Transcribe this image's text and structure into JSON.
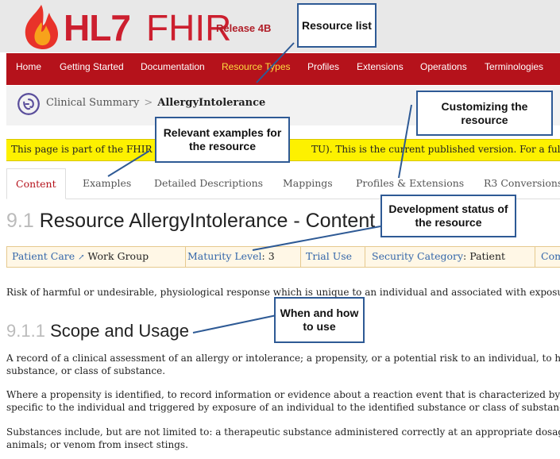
{
  "header": {
    "brand_hl7": "HL7",
    "brand_fhir": "FHIR",
    "release": "Release 4B"
  },
  "nav": [
    "Home",
    "Getting Started",
    "Documentation",
    "Resource Types",
    "Profiles",
    "Extensions",
    "Operations",
    "Terminologies"
  ],
  "breadcrumb": {
    "parent": "Clinical Summary",
    "sep": ">",
    "current": "AllergyIntolerance"
  },
  "notice": {
    "start": "This page is part of the FHIR S",
    "end": "TU). This is the current published version. For a full list o"
  },
  "tabs": [
    "Content",
    "Examples",
    "Detailed Descriptions",
    "Mappings",
    "Profiles & Extensions",
    "R3 Conversions"
  ],
  "title": {
    "num": "9.1",
    "text": "Resource AllergyIntolerance - Content"
  },
  "workgroup": {
    "patient_care": "Patient Care",
    "work_group": "Work Group",
    "maturity_label": "Maturity Level",
    "maturity_value": ": 3",
    "trial_use": "Trial Use",
    "security_label": "Security Category",
    "security_value": ": Patient",
    "compartments": "Com"
  },
  "description": "Risk of harmful or undesirable, physiological response which is unique to an individual and associated with exposure",
  "scope": {
    "num": "9.1.1",
    "title": "Scope and Usage",
    "p1_line1": "A record of a clinical assessment of an allergy or intolerance; a propensity, or a potential risk to an individual, to hav",
    "p1_line2": "substance, or class of substance.",
    "p2_line1": "Where a propensity is identified, to record information or evidence about a reaction event that is characterized by an",
    "p2_line2": "specific to the individual and triggered by exposure of an individual to the identified substance or class of substance.",
    "p3_line1": "Substances include, but are not limited to: a therapeutic substance administered correctly at an appropriate dosage",
    "p3_line2": "animals; or venom from insect stings."
  },
  "callouts": {
    "resource_list": "Resource list",
    "customizing": "Customizing the resource",
    "examples": "Relevant examples for the resource",
    "dev_status": "Development status of the resource",
    "when_how": "When and how to use"
  },
  "colors": {
    "nav_bg": "#b5121b",
    "nav_active": "#fdde40",
    "brand_red": "#cc1f2f",
    "notice_bg": "#fdf100",
    "callout_border": "#2e5a95"
  },
  "icons": {
    "logo": "flame-icon",
    "breadcrumb": "allergy-icon",
    "external": "external-link-icon"
  }
}
